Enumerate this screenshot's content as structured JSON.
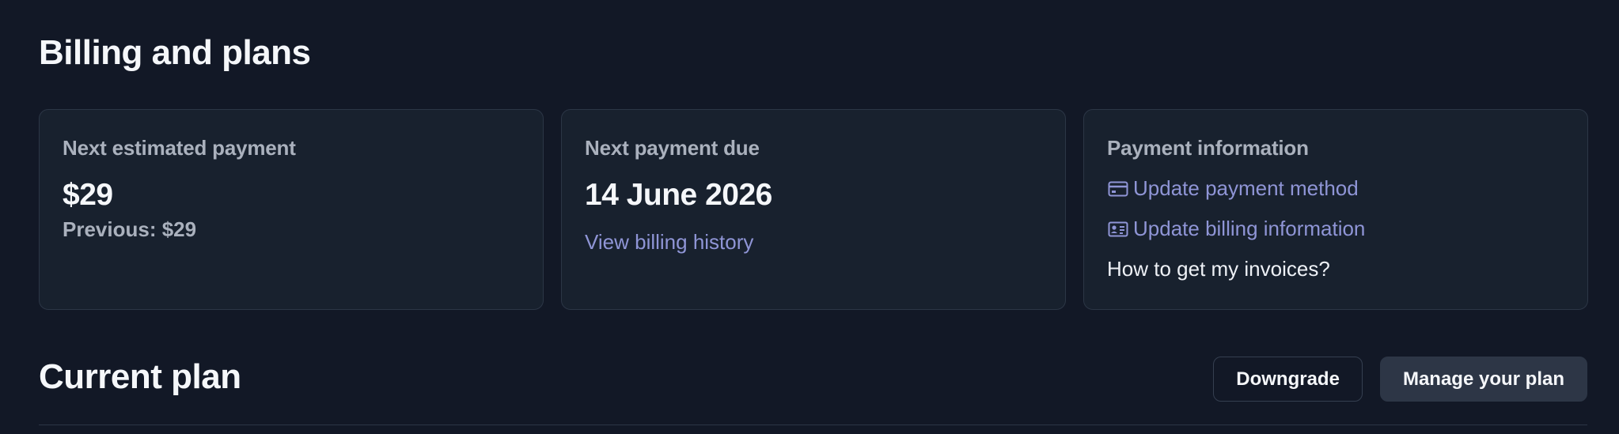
{
  "page": {
    "title": "Billing and plans"
  },
  "cards": {
    "estimated": {
      "label": "Next estimated payment",
      "amount": "$29",
      "previous": "Previous: $29"
    },
    "due": {
      "label": "Next payment due",
      "date": "14 June 2026",
      "history_link": "View billing history"
    },
    "payment_info": {
      "label": "Payment information",
      "update_method": "Update payment method",
      "update_billing": "Update billing information",
      "invoices": "How to get my invoices?"
    }
  },
  "plan": {
    "title": "Current plan",
    "downgrade_label": "Downgrade",
    "manage_label": "Manage your plan"
  },
  "colors": {
    "background": "#121826",
    "card": "#18212e",
    "link": "#8f95d6",
    "button": "#2d3646"
  },
  "icons": [
    "credit-card-icon",
    "id-card-icon"
  ]
}
